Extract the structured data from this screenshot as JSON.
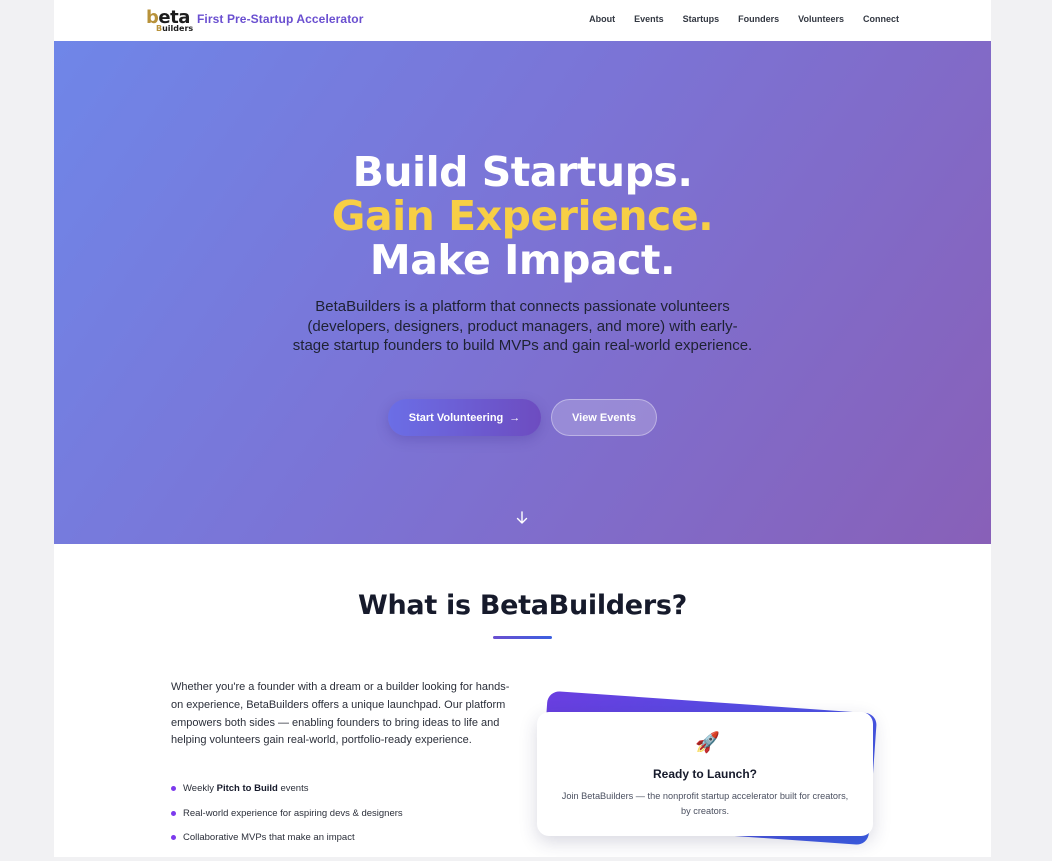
{
  "brand": {
    "logo_b": "b",
    "logo_rest": "eta",
    "logo_sub_b": "B",
    "logo_sub_rest": "uilders",
    "tagline": "First Pre-Startup Accelerator"
  },
  "nav": {
    "links": [
      "About",
      "Events",
      "Startups",
      "Founders",
      "Volunteers",
      "Connect"
    ]
  },
  "hero": {
    "line1": "Build Startups.",
    "line2": "Gain Experience.",
    "line3": "Make Impact.",
    "description": "BetaBuilders is a platform that connects passionate volunteers (developers, designers, product managers, and more) with early-stage startup founders to build MVPs and gain real-world experience.",
    "primary_button": "Start Volunteering",
    "primary_arrow": "→",
    "secondary_button": "View Events",
    "scroll_icon": "arrow-down-icon"
  },
  "about": {
    "title": "What is BetaBuilders?",
    "text": "Whether you're a founder with a dream or a builder looking for hands-on experience, BetaBuilders offers a unique launchpad. Our platform empowers both sides — enabling founders to bring ideas to life and helping volunteers gain real-world, portfolio-ready experience.",
    "bullet1_pre": "Weekly ",
    "bullet1_bold": "Pitch to Build",
    "bullet1_post": " events",
    "bullet2": "Real-world experience for aspiring devs & designers",
    "bullet3": "Collaborative MVPs that make an impact"
  },
  "card": {
    "icon": "🚀",
    "title": "Ready to Launch?",
    "description": "Join BetaBuilders — the nonprofit startup accelerator built for creators, by creators."
  },
  "colors": {
    "accent": "#6a4fd0",
    "highlight": "#f7cf45",
    "hero_start": "#6f86e8",
    "hero_end": "#8860b8"
  }
}
